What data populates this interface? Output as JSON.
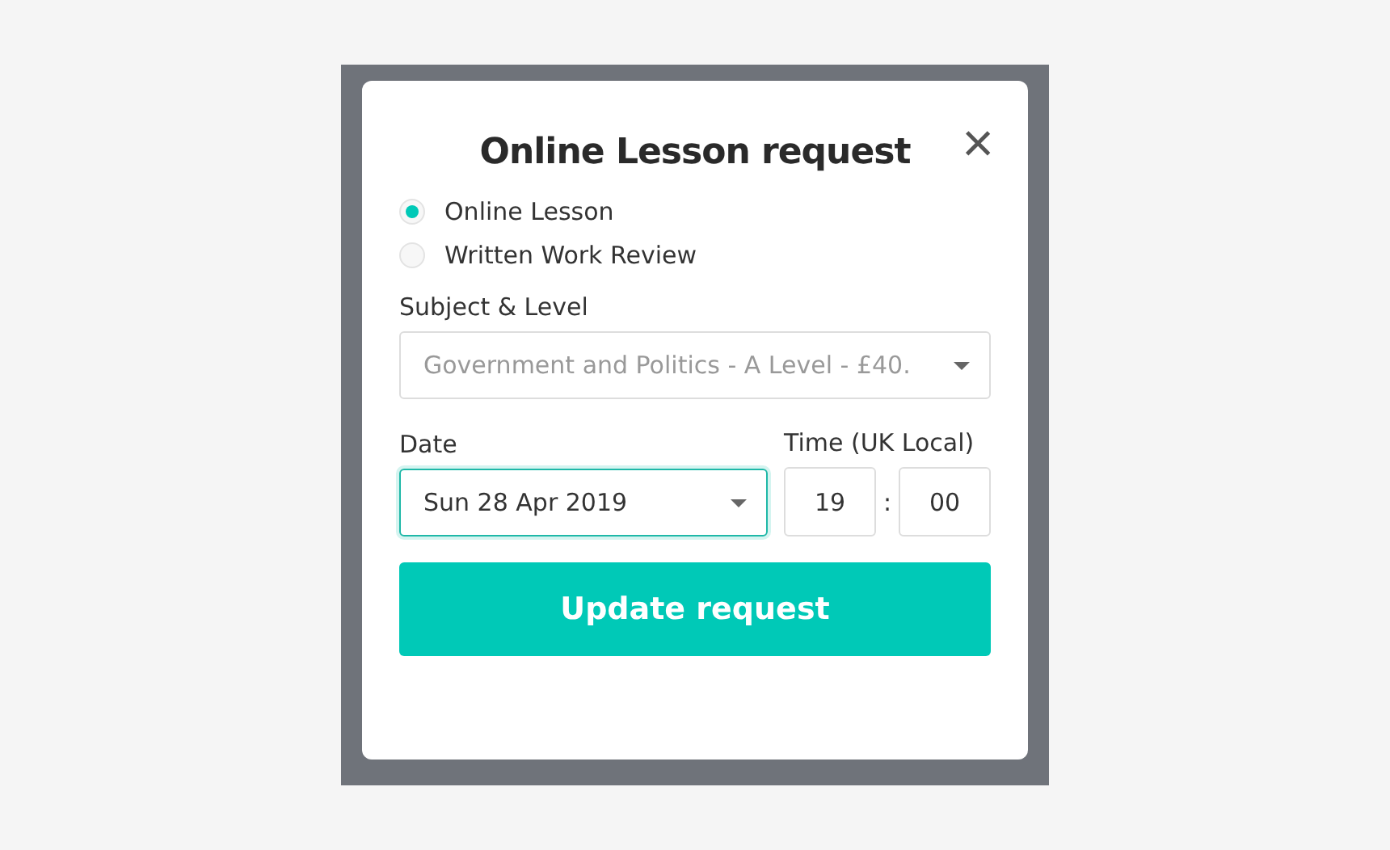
{
  "dialog": {
    "title": "Online Lesson request",
    "close_label": "×",
    "lesson_types": [
      {
        "label": "Online Lesson",
        "selected": true
      },
      {
        "label": "Written Work Review",
        "selected": false
      }
    ],
    "subject": {
      "label": "Subject & Level",
      "value": "Government and Politics - A Level - £40."
    },
    "date": {
      "label": "Date",
      "value": "Sun 28 Apr 2019"
    },
    "time": {
      "label": "Time (UK Local)",
      "hour": "19",
      "separator": ":",
      "minute": "00"
    },
    "submit": "Update request"
  }
}
